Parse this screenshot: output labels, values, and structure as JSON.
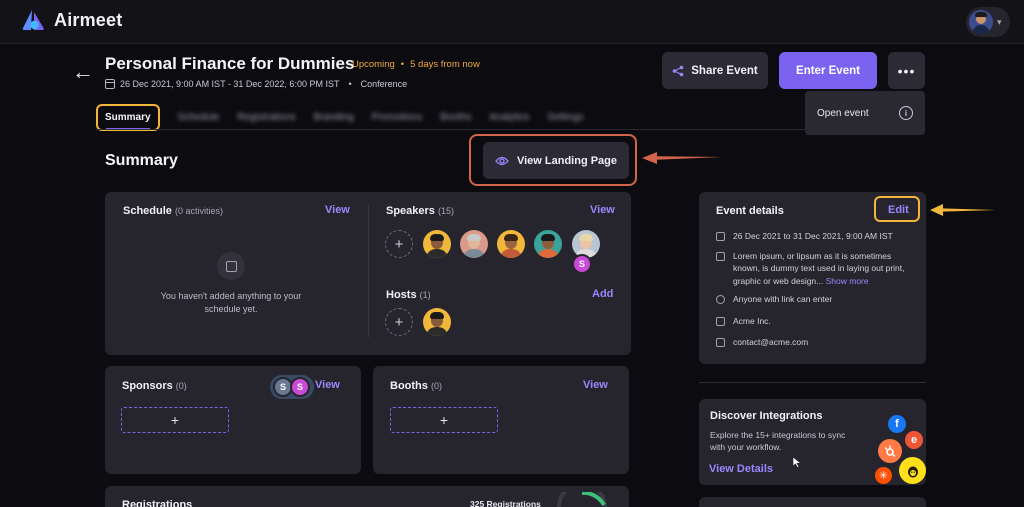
{
  "app": {
    "name": "Airmeet"
  },
  "event": {
    "title": "Personal Finance for Dummies",
    "status": "Upcoming",
    "countdown": "5 days from now",
    "dates": "26 Dec 2021, 9:00 AM IST - 31 Dec 2022, 6:00 PM IST",
    "separator": "•",
    "type": "Conference"
  },
  "actions": {
    "share_label": "Share Event",
    "enter_label": "Enter Event",
    "more_label": "•••",
    "dropdown_item": "Open event",
    "dropdown_info": "i"
  },
  "tabs": [
    {
      "label": "Summary",
      "active": true
    },
    {
      "label": "Schedule"
    },
    {
      "label": "Registrations"
    },
    {
      "label": "Branding"
    },
    {
      "label": "Promotions"
    },
    {
      "label": "Booths"
    },
    {
      "label": "Analytics"
    },
    {
      "label": "Settings"
    }
  ],
  "summary": {
    "title": "Summary",
    "landing_label": "View Landing Page"
  },
  "schedule": {
    "title": "Schedule",
    "count": "(0 activities)",
    "view": "View",
    "empty": "You haven't added anything to your schedule yet."
  },
  "speakers": {
    "title": "Speakers",
    "count": "(15)",
    "view": "View",
    "plus": "+",
    "more_badge": "S"
  },
  "hosts": {
    "title": "Hosts",
    "count": "(1)",
    "add": "Add",
    "plus": "+"
  },
  "sponsors": {
    "title": "Sponsors",
    "count": "(0)",
    "view": "View",
    "plus": "+",
    "badge_a": "S",
    "badge_b": "S"
  },
  "booths": {
    "title": "Booths",
    "count": "(0)",
    "view": "View",
    "plus": "+"
  },
  "registrations": {
    "title": "Registrations",
    "count": "325 Registrations"
  },
  "event_details": {
    "title": "Event details",
    "edit": "Edit",
    "dates": "26 Dec 2021 to 31 Dec 2021, 9:00 AM IST",
    "description": "Lorem ipsum, or lipsum as it is sometimes known, is dummy text used in laying out print, graphic or web design...",
    "show_more": "Show more",
    "access": "Anyone with link can enter",
    "organizer": "Acme Inc.",
    "email": "contact@acme.com"
  },
  "integrations": {
    "title": "Discover Integrations",
    "text": "Explore the 15+ integrations to sync with your workflow.",
    "link": "View Details",
    "icon_f": "f",
    "icon_e": "e"
  },
  "colors": {
    "accent": "#7b63f0",
    "link": "#9b86ff",
    "status": "#f0a93a",
    "highlight_orange": "#f2b63a",
    "annotation_red": "#d3634a"
  }
}
